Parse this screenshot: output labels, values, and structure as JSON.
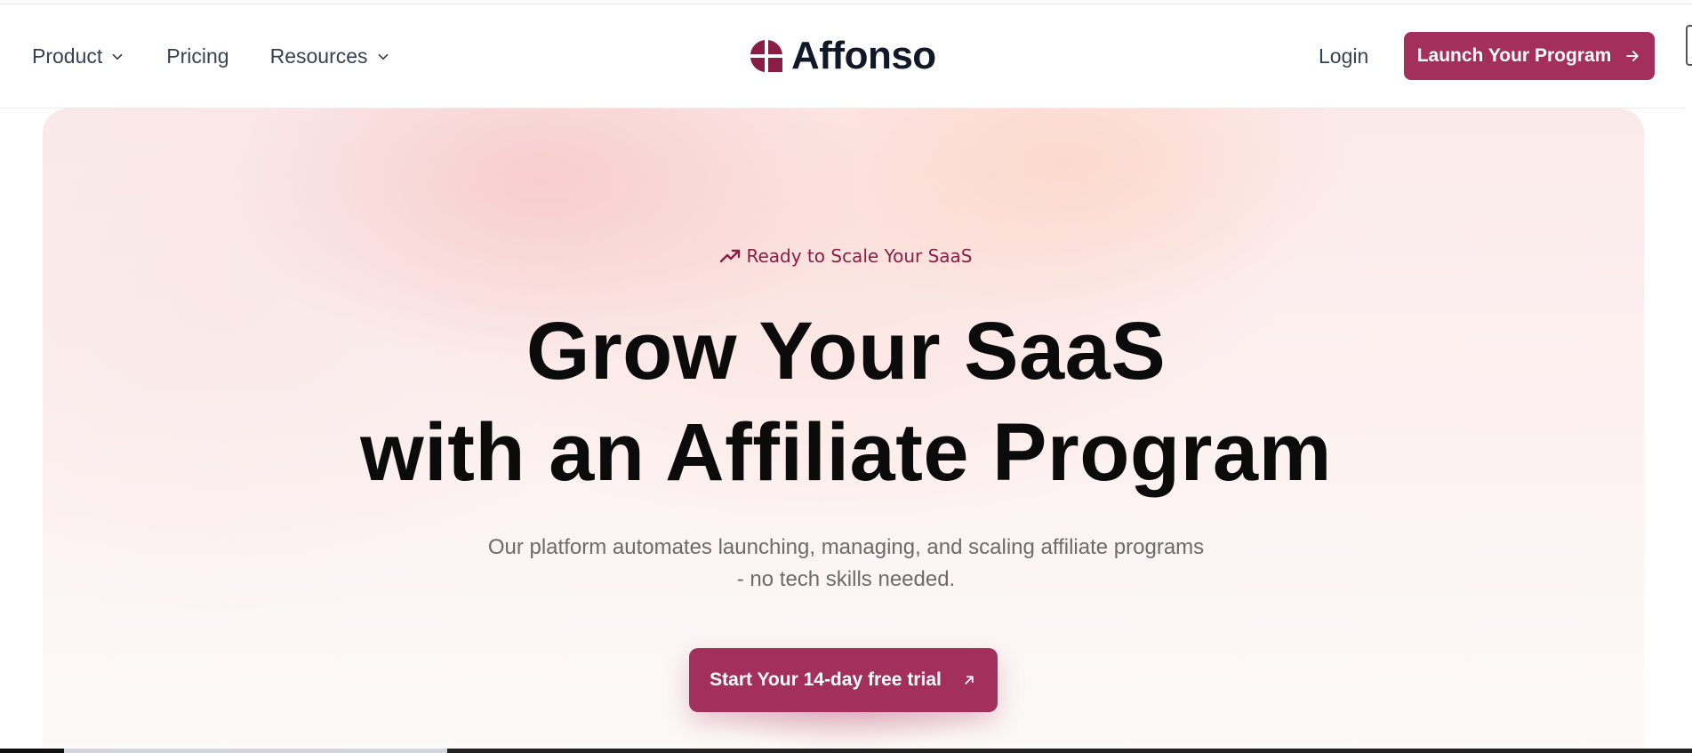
{
  "nav": {
    "product_label": "Product",
    "pricing_label": "Pricing",
    "resources_label": "Resources"
  },
  "brand": {
    "name": "Affonso",
    "accent_color": "#a3305c",
    "logo_color": "#8a1d45"
  },
  "header_actions": {
    "login_label": "Login",
    "launch_label": "Launch Your Program"
  },
  "hero": {
    "tagline": "Ready to Scale Your SaaS",
    "headline_line1": "Grow Your SaaS",
    "headline_line2": "with an Affiliate Program",
    "subtext_line1": "Our platform automates launching, managing, and scaling affiliate programs",
    "subtext_line2": "- no tech skills needed.",
    "cta_label": "Start Your 14-day free trial"
  },
  "icons": {
    "chevron": "chevron-down-icon",
    "launch_arrow": "arrow-right-icon",
    "trend": "trending-up-icon",
    "cta_arrow": "arrow-up-right-icon"
  }
}
